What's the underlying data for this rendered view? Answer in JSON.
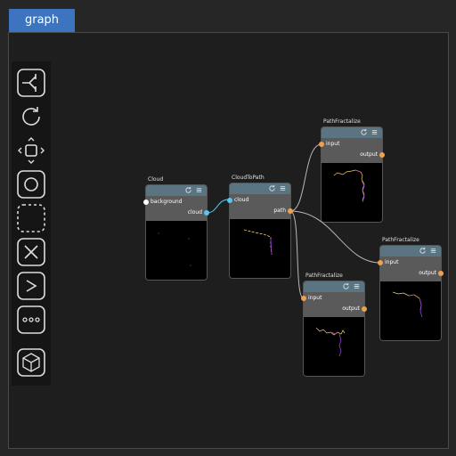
{
  "tab": {
    "label": "graph"
  },
  "colors": {
    "tab": "#3c74c0",
    "node_header": "#5b7482",
    "port_white": "#ffffff",
    "port_cyan": "#56c8f0",
    "port_orange": "#f0a050",
    "link": "#b8b8b8"
  },
  "toolbar": {
    "tools": [
      "branch-icon",
      "rotate-icon",
      "move-icon",
      "circle-icon",
      "selection-icon",
      "delete-icon",
      "greater-than-icon",
      "more-icon",
      "cube-icon"
    ]
  },
  "nodes": {
    "cloud": {
      "title": "Cloud",
      "in_label": "background",
      "out_label": "cloud"
    },
    "cloudtopath": {
      "title": "CloudToPath",
      "in_label": "cloud",
      "out_label": "path"
    },
    "pf1": {
      "title": "PathFractalize",
      "in_label": "input",
      "out_label": "output"
    },
    "pf2": {
      "title": "PathFractalize",
      "in_label": "input",
      "out_label": "output"
    },
    "pf3": {
      "title": "PathFractalize",
      "in_label": "input",
      "out_label": "output"
    }
  }
}
